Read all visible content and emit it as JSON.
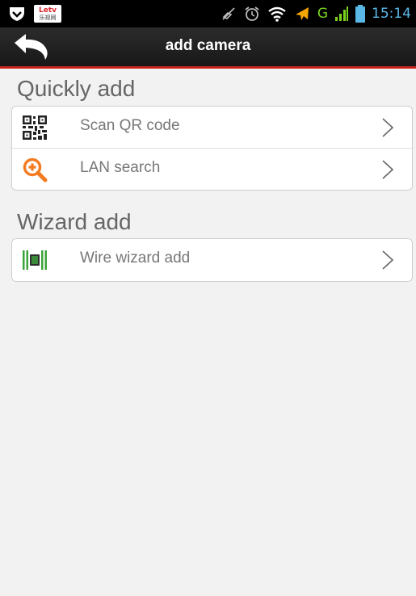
{
  "status_bar": {
    "time": "15:14",
    "badge_line1": "Letv",
    "badge_line2": "乐视网",
    "network": "G"
  },
  "header": {
    "title": "add camera"
  },
  "sections": [
    {
      "title": "Quickly add",
      "items": [
        {
          "label": "Scan QR code",
          "icon": "qr-code-icon"
        },
        {
          "label": "LAN search",
          "icon": "magnify-plus-icon"
        }
      ]
    },
    {
      "title": "Wizard add",
      "items": [
        {
          "label": "Wire wizard add",
          "icon": "wire-camera-icon"
        }
      ]
    }
  ],
  "colors": {
    "accent": "#c8241c",
    "search_icon": "#f47b20",
    "wire_icon": "#3aa53a",
    "time": "#5ab8e6"
  }
}
